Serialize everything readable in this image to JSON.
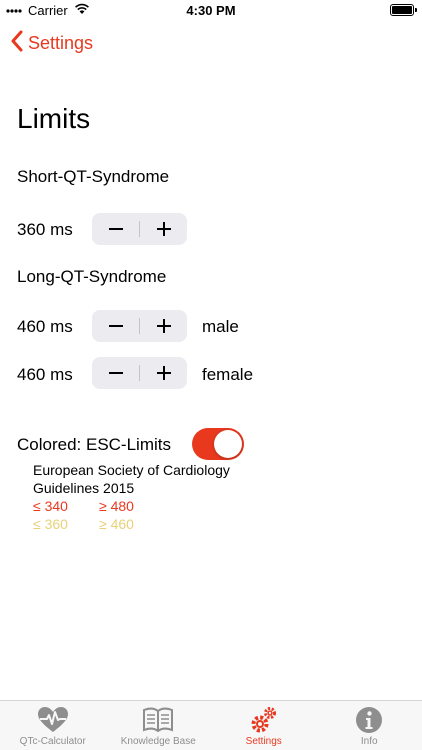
{
  "status_bar": {
    "carrier": "Carrier",
    "time": "4:30 PM"
  },
  "nav": {
    "back_label": "Settings"
  },
  "page": {
    "title": "Limits"
  },
  "short_qt": {
    "label": "Short-QT-Syndrome",
    "value": "360 ms"
  },
  "long_qt": {
    "label": "Long-QT-Syndrome",
    "male_value": "460 ms",
    "male_label": "male",
    "female_value": "460 ms",
    "female_label": "female"
  },
  "esc": {
    "label": "Colored: ESC-Limits",
    "enabled": true,
    "description_line1": "European Society of Cardiology",
    "description_line2": "Guidelines 2015",
    "red_low": "≤ 340",
    "red_high": "≥ 480",
    "yellow_low": "≤ 360",
    "yellow_high": "≥ 460",
    "red_color": "#e8391f",
    "yellow_color": "#e8d17a"
  },
  "tabs": [
    {
      "label": "QTc-Calculator",
      "icon": "heart-pulse-icon",
      "active": false
    },
    {
      "label": "Knowledge Base",
      "icon": "book-icon",
      "active": false
    },
    {
      "label": "Settings",
      "icon": "gears-icon",
      "active": true
    },
    {
      "label": "Info",
      "icon": "info-icon",
      "active": false
    }
  ],
  "colors": {
    "accent": "#e8391f",
    "inactive": "#8e8e8e",
    "stepper_bg": "#ececf0"
  }
}
